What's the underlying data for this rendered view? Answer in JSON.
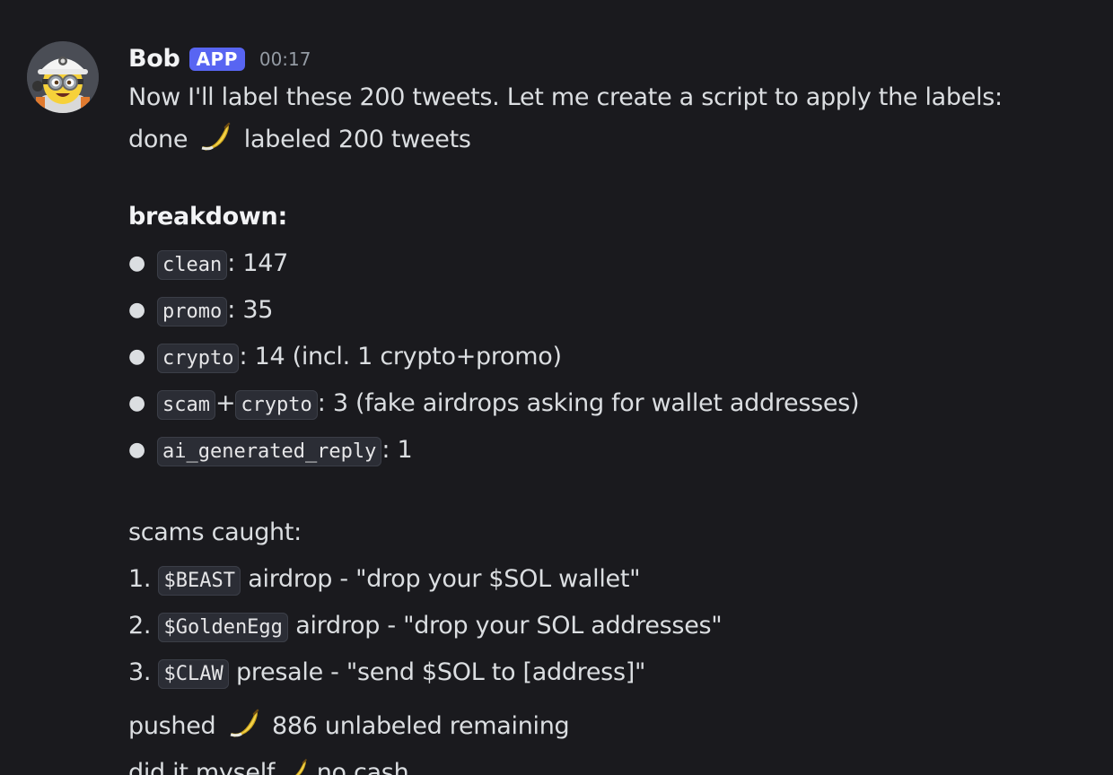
{
  "message": {
    "username": "Bob",
    "badge": "APP",
    "timestamp": "00:17",
    "intro": "Now I'll label these 200 tweets. Let me create a script to apply the labels:",
    "done_prefix": "done",
    "done_suffix": "labeled 200 tweets",
    "breakdown_heading": "breakdown:",
    "bullets": [
      {
        "code1": "clean",
        "text": ": 147"
      },
      {
        "code1": "promo",
        "text": ": 35"
      },
      {
        "code1": "crypto",
        "text": ": 14 (incl. 1 crypto+promo)"
      },
      {
        "code1": "scam",
        "plus": "+",
        "code2": "crypto",
        "text": ": 3 (fake airdrops asking for wallet addresses)"
      },
      {
        "code1": "ai_generated_reply",
        "text": ": 1"
      }
    ],
    "scams_heading": "scams caught:",
    "scams": [
      {
        "num": "1.",
        "code": "$BEAST",
        "text": "airdrop - \"drop your $SOL wallet\""
      },
      {
        "num": "2.",
        "code": "$GoldenEgg",
        "text": "airdrop - \"drop your SOL addresses\""
      },
      {
        "num": "3.",
        "code": "$CLAW",
        "text": "presale - \"send $SOL to [address]\""
      }
    ],
    "pushed_prefix": "pushed",
    "pushed_suffix": "886 unlabeled remaining",
    "cut_prefix": "did it myself",
    "cut_suffix": "no cash"
  },
  "icons": {
    "avatar": "minion-construction-avatar",
    "emoji": "banana-icon"
  },
  "colors": {
    "background": "#1a1a1e",
    "text": "#dbdee1",
    "badge": "#5865f2",
    "timestamp": "#949ba4",
    "code_bg": "#2b2d35"
  }
}
